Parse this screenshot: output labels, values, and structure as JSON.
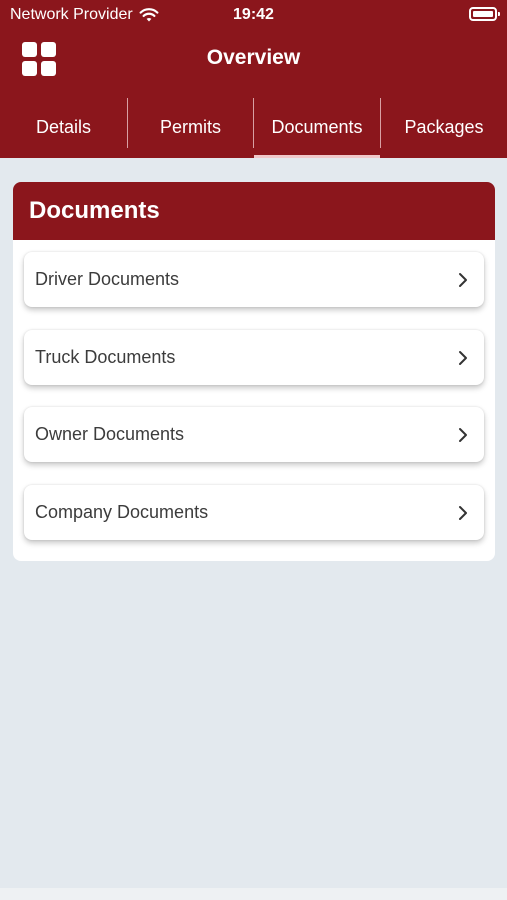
{
  "status_bar": {
    "carrier": "Network Provider",
    "time": "19:42",
    "wifi_icon": "wifi-icon",
    "battery_level": 1.0
  },
  "header": {
    "menu_icon": "grid-icon",
    "title": "Overview"
  },
  "tabs": [
    {
      "label": "Details",
      "active": false
    },
    {
      "label": "Permits",
      "active": false
    },
    {
      "label": "Documents",
      "active": true
    },
    {
      "label": "Packages",
      "active": false
    }
  ],
  "documents": {
    "title": "Documents",
    "items": [
      {
        "label": "Driver Documents",
        "icon": "chevron-right-icon"
      },
      {
        "label": "Truck Documents",
        "icon": "chevron-right-icon"
      },
      {
        "label": "Owner Documents",
        "icon": "chevron-right-icon"
      },
      {
        "label": "Company Documents",
        "icon": "chevron-right-icon"
      }
    ]
  },
  "colors": {
    "brand": "#8b161c",
    "background": "#e3e9ee",
    "card": "#ffffff",
    "text": "#3c3c3c"
  }
}
